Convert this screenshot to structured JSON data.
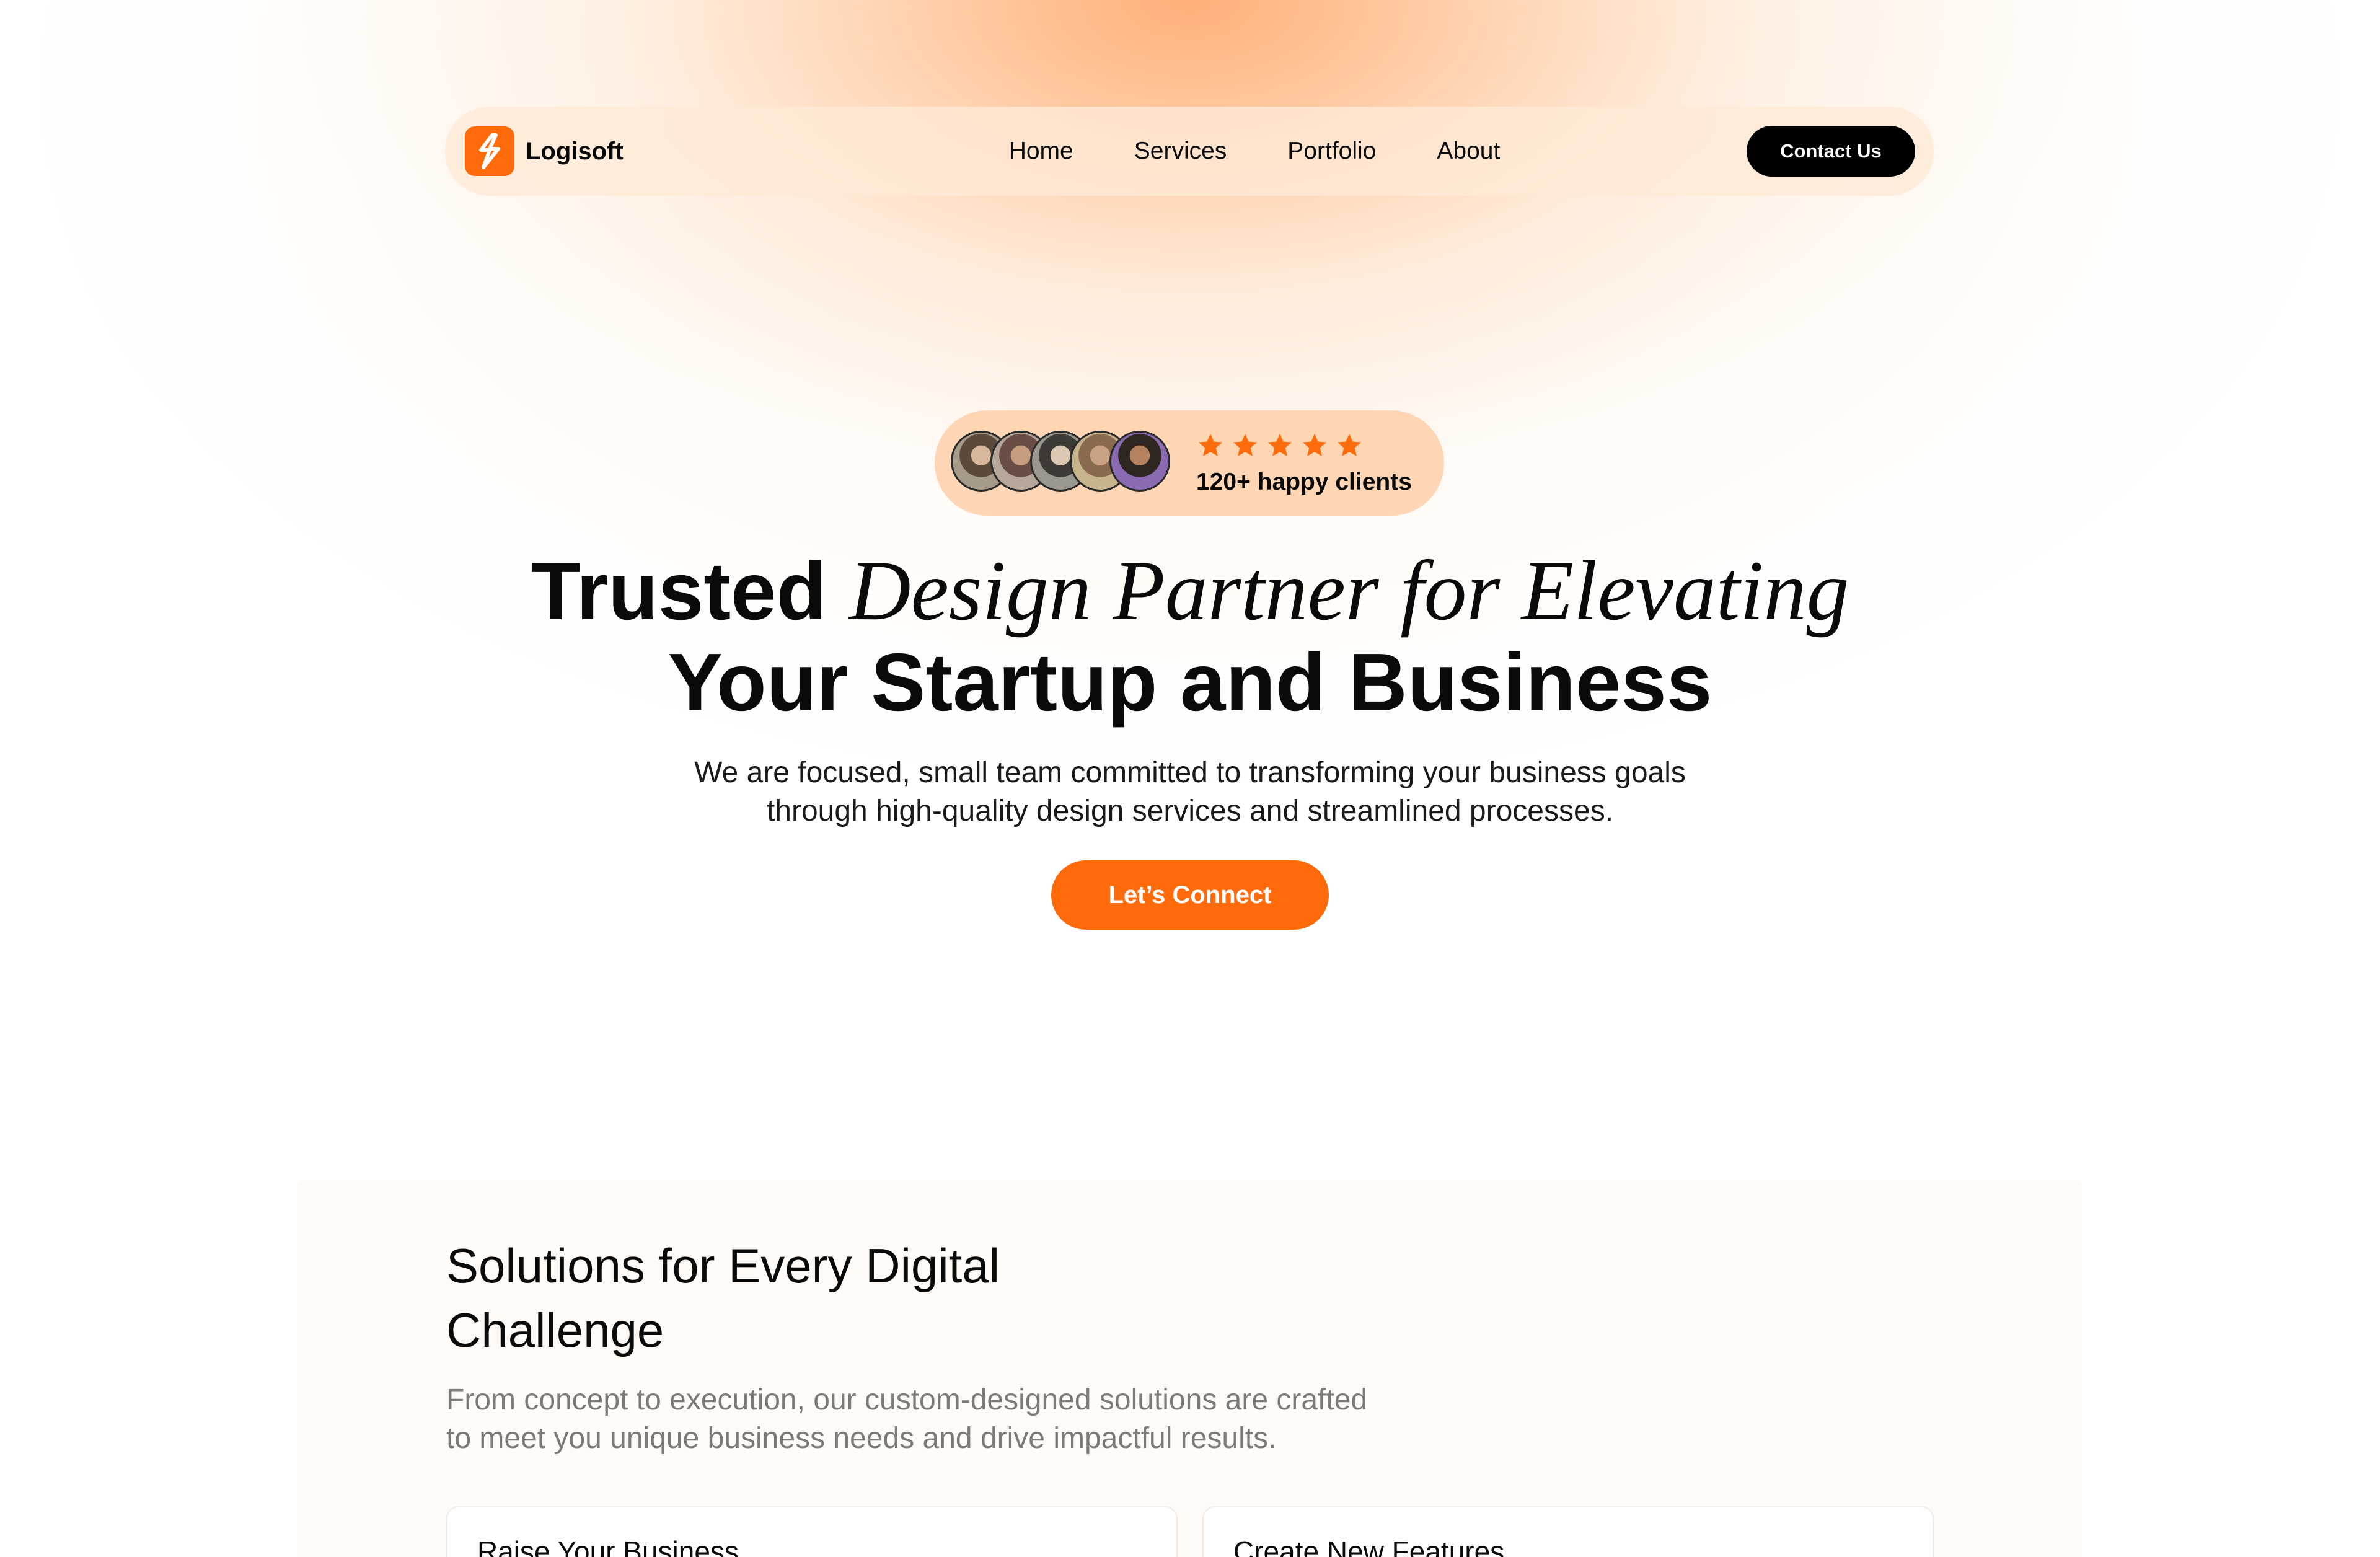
{
  "brand": {
    "name": "Logisoft",
    "accent": "#ff6b0a"
  },
  "nav": {
    "links": [
      "Home",
      "Services",
      "Portfolio",
      "About"
    ],
    "contact_label": "Contact Us"
  },
  "hero": {
    "rating_stars": 5,
    "clients_text": "120+ happy clients",
    "headline_line1_plain": "Trusted ",
    "headline_line1_italic": "Design Partner for Elevating",
    "headline_line2": "Your Startup and Business",
    "subtext_line1": "We are focused, small team committed to transforming your business goals",
    "subtext_line2": "through high-quality design services and streamlined processes.",
    "cta_label": "Let’s Connect"
  },
  "solutions": {
    "title_line1": "Solutions for Every Digital",
    "title_line2": "Challenge",
    "subtitle_line1": "From concept to execution, our custom-designed solutions are crafted",
    "subtitle_line2": "to meet you unique business needs and drive impactful results.",
    "cards": [
      {
        "title": "Raise Your Business"
      },
      {
        "title": "Create New Features"
      }
    ]
  }
}
